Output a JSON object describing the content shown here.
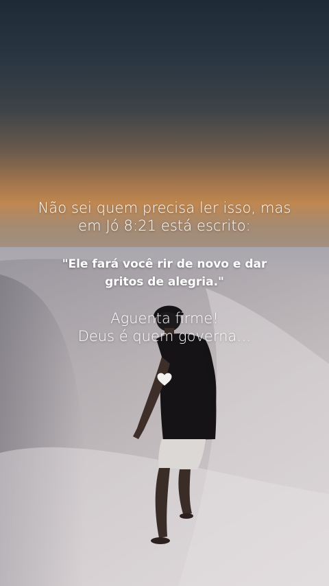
{
  "post": {
    "intro_line1": "Não sei quem precisa ler isso, mas",
    "intro_line2": "em Jó 8:21 está escrito:",
    "quote_line1": "\"Ele fará você rir de novo e dar",
    "quote_line2": "gritos de alegria.\"",
    "encourage_line1": "Aguenta firme!",
    "encourage_line2": "Deus é quem governa…",
    "heart_icon": "white-heart-icon"
  },
  "colors": {
    "text": "#ffffff",
    "sky_top": "#1e2b36",
    "sunset": "#c08750",
    "sand": "#d9d4d6"
  }
}
